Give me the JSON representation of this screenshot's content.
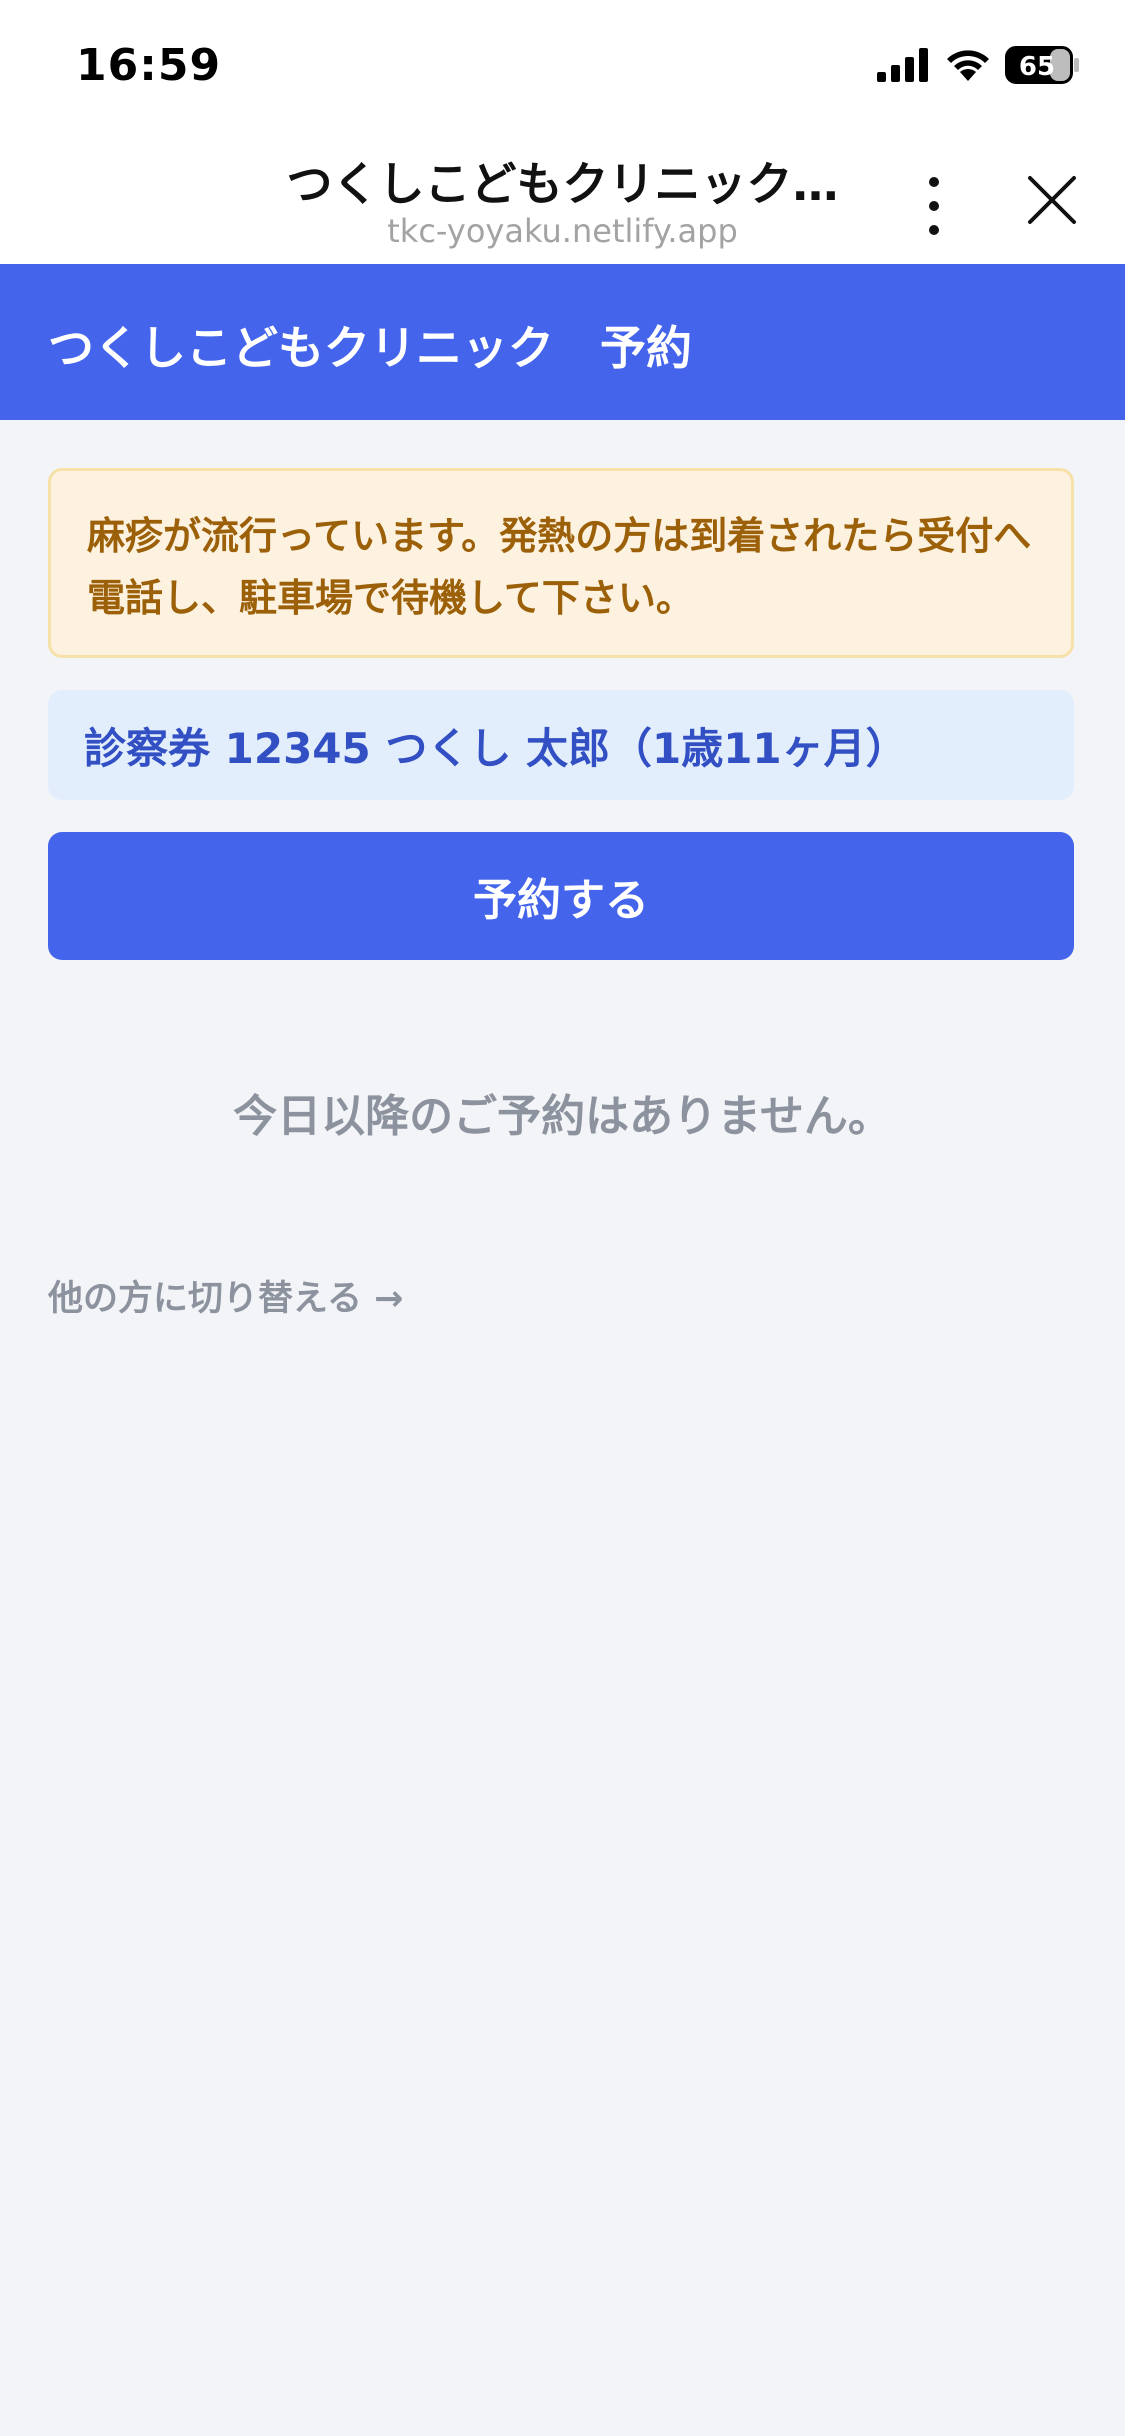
{
  "status_bar": {
    "time": "16:59",
    "battery_level": "65",
    "icons": [
      "signal-icon",
      "wifi-icon",
      "battery-icon"
    ]
  },
  "browser": {
    "title": "つくしこどもクリニック…",
    "url": "tkc-yoyaku.netlify.app",
    "icons": [
      "more-vertical-icon",
      "close-icon"
    ]
  },
  "header": {
    "title": "つくしこどもクリニック　予約"
  },
  "notice": {
    "text": "麻疹が流行っています。発熱の方は到着されたら受付へ電話し、駐車場で待機して下さい。"
  },
  "patient": {
    "label": "診察券  12345 つくし 太郎（1歳11ヶ月）"
  },
  "actions": {
    "reserve_label": "予約する",
    "switch_label": "他の方に切り替える →"
  },
  "reservations": {
    "empty_message": "今日以降のご予約はありません。"
  },
  "colors": {
    "brand": "#4464ec",
    "notice_bg": "#fdf2e0",
    "notice_text": "#9b6008",
    "patient_bg": "#e3eefc",
    "muted_text": "#8c939e",
    "page_bg": "#f3f4f8"
  }
}
